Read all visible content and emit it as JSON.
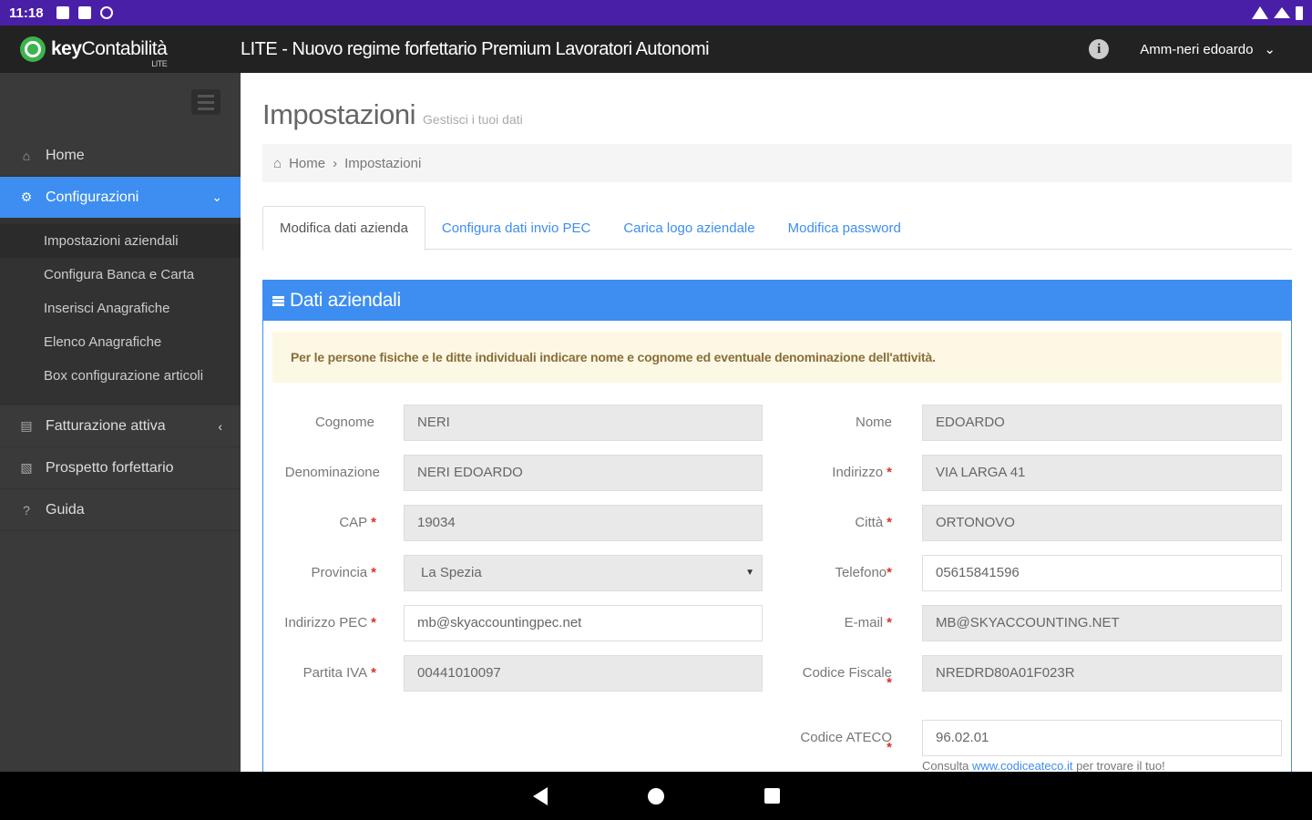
{
  "status_bar": {
    "time": "11:18"
  },
  "top_bar": {
    "logo_bold": "key",
    "logo_rest": "Contabilità",
    "logo_sub": "LITE",
    "title": "LITE - Nuovo regime forfettario Premium Lavoratori Autonomi",
    "user": "Amm-neri edoardo",
    "info_glyph": "i"
  },
  "sidebar": {
    "items": [
      {
        "label": "Home",
        "icon": "home-icon"
      },
      {
        "label": "Configurazioni",
        "icon": "gears-icon"
      },
      {
        "label": "Fatturazione attiva",
        "icon": "document-icon"
      },
      {
        "label": "Prospetto forfettario",
        "icon": "book-icon"
      },
      {
        "label": "Guida",
        "icon": "question-icon"
      }
    ],
    "submenu": [
      "Impostazioni aziendali",
      "Configura Banca e Carta",
      "Inserisci Anagrafiche",
      "Elenco Anagrafiche",
      "Box configurazione articoli"
    ]
  },
  "page": {
    "title": "Impostazioni",
    "subtitle": "Gestisci i tuoi dati",
    "breadcrumb": [
      "Home",
      "Impostazioni"
    ]
  },
  "tabs": [
    "Modifica dati azienda",
    "Configura dati invio PEC",
    "Carica logo aziendale",
    "Modifica password"
  ],
  "panel": {
    "title": "Dati aziendali",
    "alert": "Per le persone fisiche e le ditte individuali indicare nome e cognome ed eventuale denominazione dell'attività."
  },
  "form": {
    "cognome": {
      "label": "Cognome",
      "value": "NERI"
    },
    "nome": {
      "label": "Nome",
      "value": "EDOARDO"
    },
    "denominazione": {
      "label": "Denominazione",
      "value": "NERI EDOARDO"
    },
    "indirizzo": {
      "label": "Indirizzo",
      "value": "VIA LARGA 41"
    },
    "cap": {
      "label": "CAP",
      "value": "19034"
    },
    "citta": {
      "label": "Città",
      "value": "ORTONOVO"
    },
    "provincia": {
      "label": "Provincia",
      "value": "La Spezia"
    },
    "telefono": {
      "label": "Telefono",
      "value": "05615841596"
    },
    "pec": {
      "label": "Indirizzo PEC",
      "value": "mb@skyaccountingpec.net"
    },
    "email": {
      "label": "E-mail",
      "value": "MB@SKYACCOUNTING.NET"
    },
    "piva": {
      "label": "Partita IVA",
      "value": "00441010097"
    },
    "cf": {
      "label": "Codice Fiscale",
      "value": "NREDRD80A01F023R"
    },
    "ateco": {
      "label": "Codice ATECO",
      "value": "96.02.01"
    },
    "required_mark": "*",
    "ateco_help_pre": "Consulta",
    "ateco_help_link": "www.codiceateco.it",
    "ateco_help_post": "per trovare il tuo!"
  },
  "colors": {
    "accent": "#3d8ef0",
    "status_bar": "#4a1fa8",
    "sidebar": "#3a3a3a",
    "alert_bg": "#fcf8e3"
  }
}
